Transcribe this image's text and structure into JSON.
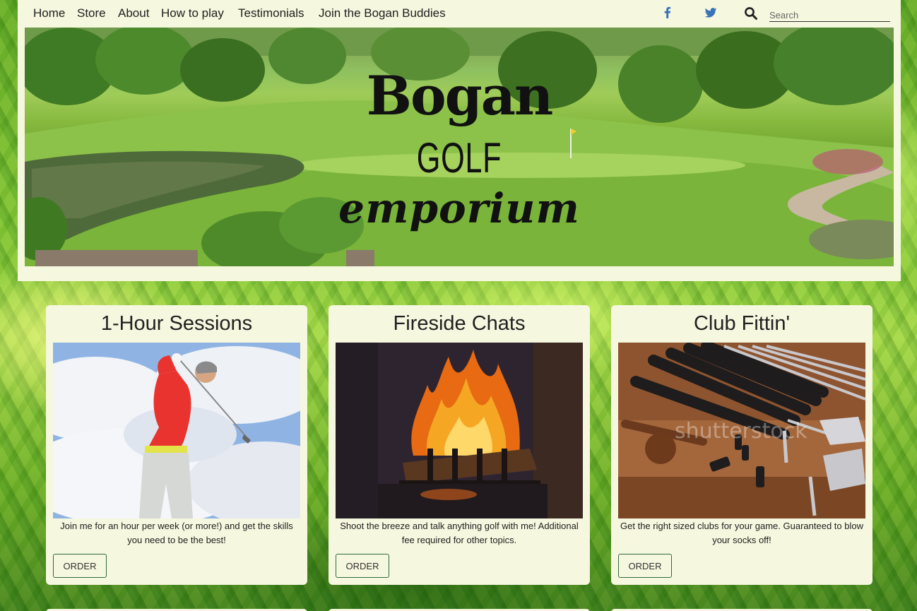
{
  "nav": {
    "items": [
      "Home",
      "Store",
      "About",
      "How to play",
      "Testimonials",
      "Join the Bogan Buddies"
    ]
  },
  "social": {
    "facebook_icon": "facebook-icon",
    "twitter_icon": "twitter-icon",
    "color": "#3b5998"
  },
  "search": {
    "placeholder": "Search",
    "icon": "search-icon"
  },
  "banner": {
    "line1": "Bogan",
    "line2": "GOLF",
    "line3": "emporium"
  },
  "cards": [
    {
      "title": "1-Hour Sessions",
      "text": "Join me for an hour per week (or more!) and get the skills you need to be the best!",
      "button": "ORDER"
    },
    {
      "title": "Fireside Chats",
      "text": "Shoot the breeze and talk anything golf with me! Additional fee required for other topics.",
      "button": "ORDER"
    },
    {
      "title": "Club Fittin'",
      "text": "Get the right sized clubs for your game. Guaranteed to blow your socks off!",
      "button": "ORDER",
      "watermark": "shutterstock"
    }
  ],
  "colors": {
    "panel": "#f6f7df",
    "button_border": "#2e6b3a",
    "social_blue": "#3b73b9"
  }
}
